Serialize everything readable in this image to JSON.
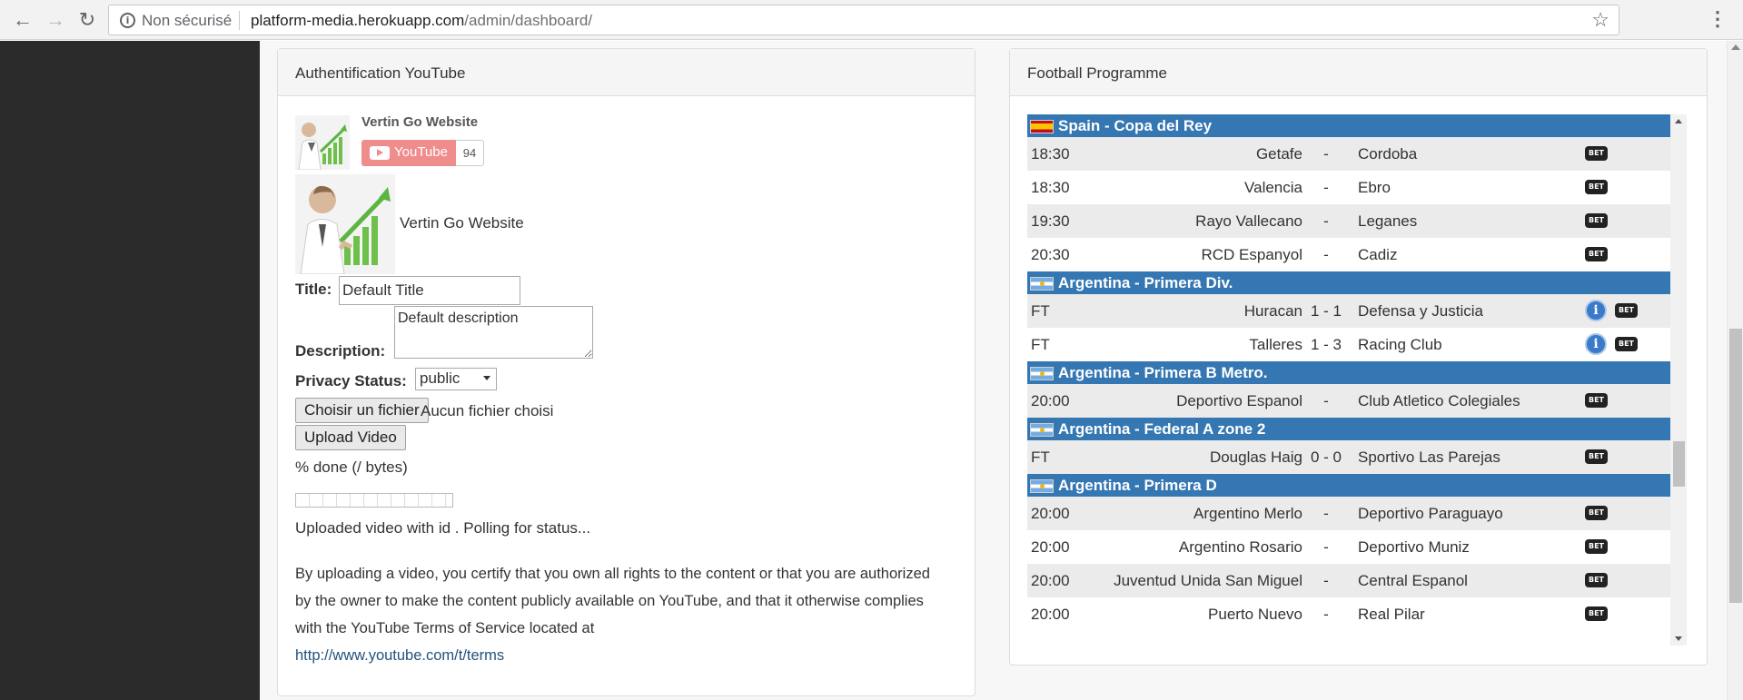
{
  "browser": {
    "security_label": "Non sécurisé",
    "url_host": "platform-media.herokuapp.com",
    "url_path": "/admin/dashboard/",
    "icons": [
      "arrow-left-icon",
      "arrow-right-icon",
      "reload-icon",
      "info-icon",
      "star-icon",
      "more-vert-icon"
    ]
  },
  "youtube_panel": {
    "heading": "Authentification YouTube",
    "channel_name": "Vertin Go Website",
    "subscribe_label": "YouTube",
    "subscriber_count": "94",
    "channel_title": "Vertin Go Website",
    "title_label": "Title:",
    "title_value": "Default Title",
    "description_label": "Description:",
    "description_value": "Default description",
    "privacy_label": "Privacy Status:",
    "privacy_selected": "public",
    "file_button": "Choisir un fichier",
    "file_status": "Aucun fichier choisi",
    "upload_button": "Upload Video",
    "progress_text": "% done (/ bytes)",
    "progress_fraction": 0,
    "upload_status": "Uploaded video with id . Polling for status...",
    "terms_text": "By uploading a video, you certify that you own all rights to the content or that you are authorized by the owner to make the content publicly available on YouTube, and that it otherwise complies with the YouTube Terms of Service located at",
    "terms_link": "http://www.youtube.com/t/terms"
  },
  "football_panel": {
    "heading": "Football Programme",
    "bet_label": "BET",
    "leagues": [
      {
        "name": "Spain - Copa del Rey",
        "flag": "spain-flag",
        "matches": [
          {
            "time": "18:30",
            "home": "Getafe",
            "score": "-",
            "away": "Cordoba",
            "info": false
          },
          {
            "time": "18:30",
            "home": "Valencia",
            "score": "-",
            "away": "Ebro",
            "info": false
          },
          {
            "time": "19:30",
            "home": "Rayo Vallecano",
            "score": "-",
            "away": "Leganes",
            "info": false
          },
          {
            "time": "20:30",
            "home": "RCD Espanyol",
            "score": "-",
            "away": "Cadiz",
            "info": false
          }
        ]
      },
      {
        "name": "Argentina - Primera Div.",
        "flag": "argentina-flag",
        "matches": [
          {
            "time": "FT",
            "home": "Huracan",
            "score": "1 - 1",
            "away": "Defensa y Justicia",
            "info": true
          },
          {
            "time": "FT",
            "home": "Talleres",
            "score": "1 - 3",
            "away": "Racing Club",
            "info": true
          }
        ]
      },
      {
        "name": "Argentina - Primera B Metro.",
        "flag": "argentina-flag",
        "matches": [
          {
            "time": "20:00",
            "home": "Deportivo Espanol",
            "score": "-",
            "away": "Club Atletico Colegiales",
            "info": false
          }
        ]
      },
      {
        "name": "Argentina - Federal A zone 2",
        "flag": "argentina-flag",
        "matches": [
          {
            "time": "FT",
            "home": "Douglas Haig",
            "score": "0 - 0",
            "away": "Sportivo Las Parejas",
            "info": false
          }
        ]
      },
      {
        "name": "Argentina - Primera D",
        "flag": "argentina-flag",
        "matches": [
          {
            "time": "20:00",
            "home": "Argentino Merlo",
            "score": "-",
            "away": "Deportivo Paraguayo",
            "info": false
          },
          {
            "time": "20:00",
            "home": "Argentino Rosario",
            "score": "-",
            "away": "Deportivo Muniz",
            "info": false
          },
          {
            "time": "20:00",
            "home": "Juventud Unida San Miguel",
            "score": "-",
            "away": "Central Espanol",
            "info": false
          },
          {
            "time": "20:00",
            "home": "Puerto Nuevo",
            "score": "-",
            "away": "Real Pilar",
            "info": false
          }
        ]
      }
    ]
  }
}
